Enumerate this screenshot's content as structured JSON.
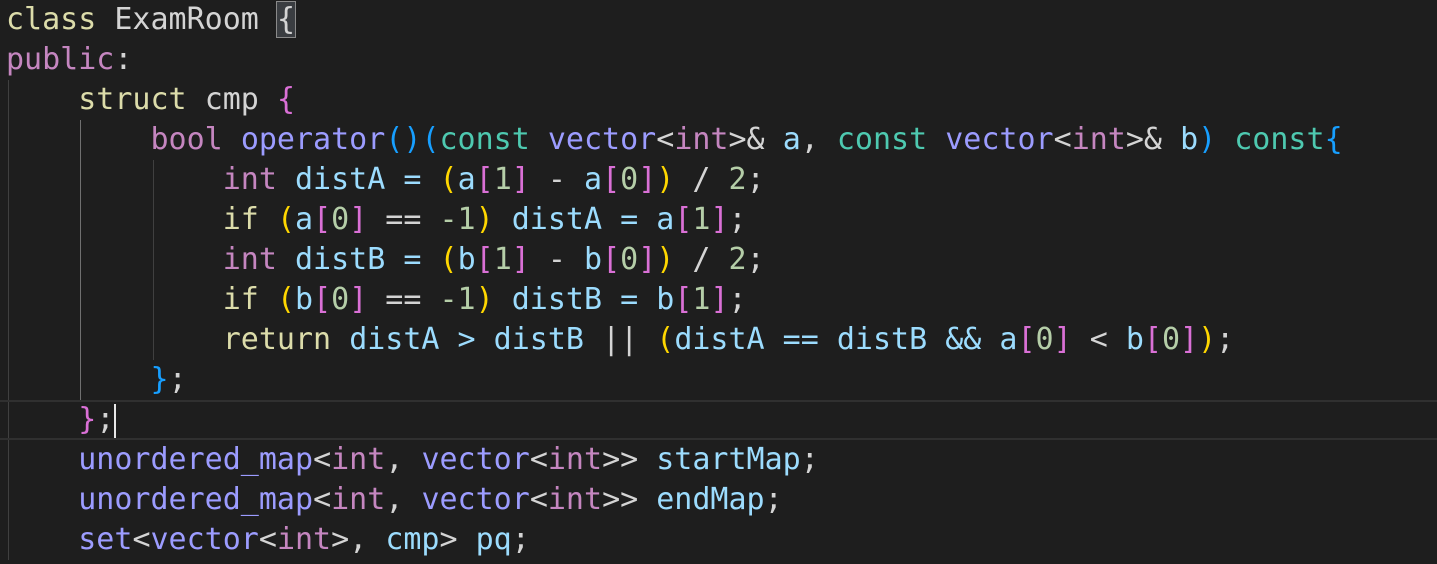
{
  "colors": {
    "background": "#1e1e1e",
    "keyword_purple": "#c586c0",
    "keyword_yellow": "#dcdcaa",
    "type_blue": "#9c9cff",
    "teal": "#4ec9b0",
    "plain": "#d4d4d4",
    "number": "#b5cea8",
    "bracket_gold": "#ffd700",
    "bracket_purple": "#da70d6",
    "bracket_blue": "#179fff"
  },
  "lines": [
    [
      {
        "t": "class ",
        "c": "#dcdcaa"
      },
      {
        "t": "ExamRoom ",
        "c": "#d4d4d4"
      },
      {
        "t": "{",
        "c": "#d4d4d4",
        "box": true
      }
    ],
    [
      {
        "t": "public",
        "c": "#c586c0"
      },
      {
        "t": ":",
        "c": "#d4d4d4"
      }
    ],
    [
      {
        "t": "    ",
        "c": "#d4d4d4"
      },
      {
        "t": "struct ",
        "c": "#dcdcaa"
      },
      {
        "t": "cmp ",
        "c": "#d4d4d4"
      },
      {
        "t": "{",
        "c": "#da70d6"
      }
    ],
    [
      {
        "t": "        ",
        "c": "#d4d4d4"
      },
      {
        "t": "bool ",
        "c": "#c586c0"
      },
      {
        "t": "operator",
        "c": "#9c9cff"
      },
      {
        "t": "()",
        "c": "#179fff"
      },
      {
        "t": "(",
        "c": "#179fff"
      },
      {
        "t": "const ",
        "c": "#4ec9b0"
      },
      {
        "t": "vector",
        "c": "#9c9cff"
      },
      {
        "t": "<",
        "c": "#d4d4d4"
      },
      {
        "t": "int",
        "c": "#c586c0"
      },
      {
        "t": ">& ",
        "c": "#d4d4d4"
      },
      {
        "t": "a",
        "c": "#9cdcfe"
      },
      {
        "t": ", ",
        "c": "#d4d4d4"
      },
      {
        "t": "const ",
        "c": "#4ec9b0"
      },
      {
        "t": "vector",
        "c": "#9c9cff"
      },
      {
        "t": "<",
        "c": "#d4d4d4"
      },
      {
        "t": "int",
        "c": "#c586c0"
      },
      {
        "t": ">& ",
        "c": "#d4d4d4"
      },
      {
        "t": "b",
        "c": "#9cdcfe"
      },
      {
        "t": ") ",
        "c": "#179fff"
      },
      {
        "t": "const",
        "c": "#4ec9b0"
      },
      {
        "t": "{",
        "c": "#179fff"
      }
    ],
    [
      {
        "t": "            ",
        "c": "#d4d4d4"
      },
      {
        "t": "int ",
        "c": "#c586c0"
      },
      {
        "t": "distA = ",
        "c": "#9cdcfe"
      },
      {
        "t": "(",
        "c": "#ffd700"
      },
      {
        "t": "a",
        "c": "#9cdcfe"
      },
      {
        "t": "[",
        "c": "#da70d6"
      },
      {
        "t": "1",
        "c": "#b5cea8"
      },
      {
        "t": "]",
        "c": "#da70d6"
      },
      {
        "t": " - ",
        "c": "#d4d4d4"
      },
      {
        "t": "a",
        "c": "#9cdcfe"
      },
      {
        "t": "[",
        "c": "#da70d6"
      },
      {
        "t": "0",
        "c": "#b5cea8"
      },
      {
        "t": "]",
        "c": "#da70d6"
      },
      {
        "t": ")",
        "c": "#ffd700"
      },
      {
        "t": " / ",
        "c": "#d4d4d4"
      },
      {
        "t": "2",
        "c": "#b5cea8"
      },
      {
        "t": ";",
        "c": "#d4d4d4"
      }
    ],
    [
      {
        "t": "            ",
        "c": "#d4d4d4"
      },
      {
        "t": "if ",
        "c": "#dcdcaa"
      },
      {
        "t": "(",
        "c": "#ffd700"
      },
      {
        "t": "a",
        "c": "#9cdcfe"
      },
      {
        "t": "[",
        "c": "#da70d6"
      },
      {
        "t": "0",
        "c": "#b5cea8"
      },
      {
        "t": "]",
        "c": "#da70d6"
      },
      {
        "t": " == ",
        "c": "#d4d4d4"
      },
      {
        "t": "-1",
        "c": "#b5cea8"
      },
      {
        "t": ")",
        "c": "#ffd700"
      },
      {
        "t": " distA = ",
        "c": "#9cdcfe"
      },
      {
        "t": "a",
        "c": "#9cdcfe"
      },
      {
        "t": "[",
        "c": "#da70d6"
      },
      {
        "t": "1",
        "c": "#b5cea8"
      },
      {
        "t": "]",
        "c": "#da70d6"
      },
      {
        "t": ";",
        "c": "#d4d4d4"
      }
    ],
    [
      {
        "t": "            ",
        "c": "#d4d4d4"
      },
      {
        "t": "int ",
        "c": "#c586c0"
      },
      {
        "t": "distB = ",
        "c": "#9cdcfe"
      },
      {
        "t": "(",
        "c": "#ffd700"
      },
      {
        "t": "b",
        "c": "#9cdcfe"
      },
      {
        "t": "[",
        "c": "#da70d6"
      },
      {
        "t": "1",
        "c": "#b5cea8"
      },
      {
        "t": "]",
        "c": "#da70d6"
      },
      {
        "t": " - ",
        "c": "#d4d4d4"
      },
      {
        "t": "b",
        "c": "#9cdcfe"
      },
      {
        "t": "[",
        "c": "#da70d6"
      },
      {
        "t": "0",
        "c": "#b5cea8"
      },
      {
        "t": "]",
        "c": "#da70d6"
      },
      {
        "t": ")",
        "c": "#ffd700"
      },
      {
        "t": " / ",
        "c": "#d4d4d4"
      },
      {
        "t": "2",
        "c": "#b5cea8"
      },
      {
        "t": ";",
        "c": "#d4d4d4"
      }
    ],
    [
      {
        "t": "            ",
        "c": "#d4d4d4"
      },
      {
        "t": "if ",
        "c": "#dcdcaa"
      },
      {
        "t": "(",
        "c": "#ffd700"
      },
      {
        "t": "b",
        "c": "#9cdcfe"
      },
      {
        "t": "[",
        "c": "#da70d6"
      },
      {
        "t": "0",
        "c": "#b5cea8"
      },
      {
        "t": "]",
        "c": "#da70d6"
      },
      {
        "t": " == ",
        "c": "#d4d4d4"
      },
      {
        "t": "-1",
        "c": "#b5cea8"
      },
      {
        "t": ")",
        "c": "#ffd700"
      },
      {
        "t": " distB = ",
        "c": "#9cdcfe"
      },
      {
        "t": "b",
        "c": "#9cdcfe"
      },
      {
        "t": "[",
        "c": "#da70d6"
      },
      {
        "t": "1",
        "c": "#b5cea8"
      },
      {
        "t": "]",
        "c": "#da70d6"
      },
      {
        "t": ";",
        "c": "#d4d4d4"
      }
    ],
    [
      {
        "t": "            ",
        "c": "#d4d4d4"
      },
      {
        "t": "return ",
        "c": "#dcdcaa"
      },
      {
        "t": "distA > distB ",
        "c": "#9cdcfe"
      },
      {
        "t": "|| ",
        "c": "#d4d4d4"
      },
      {
        "t": "(",
        "c": "#ffd700"
      },
      {
        "t": "distA == distB && ",
        "c": "#9cdcfe"
      },
      {
        "t": "a",
        "c": "#9cdcfe"
      },
      {
        "t": "[",
        "c": "#da70d6"
      },
      {
        "t": "0",
        "c": "#b5cea8"
      },
      {
        "t": "]",
        "c": "#da70d6"
      },
      {
        "t": " < ",
        "c": "#d4d4d4"
      },
      {
        "t": "b",
        "c": "#9cdcfe"
      },
      {
        "t": "[",
        "c": "#da70d6"
      },
      {
        "t": "0",
        "c": "#b5cea8"
      },
      {
        "t": "]",
        "c": "#da70d6"
      },
      {
        "t": ")",
        "c": "#ffd700"
      },
      {
        "t": ";",
        "c": "#d4d4d4"
      }
    ],
    [
      {
        "t": "        ",
        "c": "#d4d4d4"
      },
      {
        "t": "}",
        "c": "#179fff"
      },
      {
        "t": ";",
        "c": "#d4d4d4"
      }
    ],
    [
      {
        "t": "    ",
        "c": "#d4d4d4"
      },
      {
        "t": "}",
        "c": "#da70d6"
      },
      {
        "t": ";",
        "c": "#d4d4d4"
      }
    ],
    [
      {
        "t": "    ",
        "c": "#d4d4d4"
      },
      {
        "t": "unordered_map",
        "c": "#9c9cff"
      },
      {
        "t": "<",
        "c": "#d4d4d4"
      },
      {
        "t": "int",
        "c": "#c586c0"
      },
      {
        "t": ", ",
        "c": "#d4d4d4"
      },
      {
        "t": "vector",
        "c": "#9c9cff"
      },
      {
        "t": "<",
        "c": "#d4d4d4"
      },
      {
        "t": "int",
        "c": "#c586c0"
      },
      {
        "t": ">> ",
        "c": "#d4d4d4"
      },
      {
        "t": "startMap",
        "c": "#9cdcfe"
      },
      {
        "t": ";",
        "c": "#d4d4d4"
      }
    ],
    [
      {
        "t": "    ",
        "c": "#d4d4d4"
      },
      {
        "t": "unordered_map",
        "c": "#9c9cff"
      },
      {
        "t": "<",
        "c": "#d4d4d4"
      },
      {
        "t": "int",
        "c": "#c586c0"
      },
      {
        "t": ", ",
        "c": "#d4d4d4"
      },
      {
        "t": "vector",
        "c": "#9c9cff"
      },
      {
        "t": "<",
        "c": "#d4d4d4"
      },
      {
        "t": "int",
        "c": "#c586c0"
      },
      {
        "t": ">> ",
        "c": "#d4d4d4"
      },
      {
        "t": "endMap",
        "c": "#9cdcfe"
      },
      {
        "t": ";",
        "c": "#d4d4d4"
      }
    ],
    [
      {
        "t": "    ",
        "c": "#d4d4d4"
      },
      {
        "t": "set",
        "c": "#9c9cff"
      },
      {
        "t": "<",
        "c": "#d4d4d4"
      },
      {
        "t": "vector",
        "c": "#9c9cff"
      },
      {
        "t": "<",
        "c": "#d4d4d4"
      },
      {
        "t": "int",
        "c": "#c586c0"
      },
      {
        "t": ">, ",
        "c": "#d4d4d4"
      },
      {
        "t": "cmp",
        "c": "#9cdcfe"
      },
      {
        "t": "> ",
        "c": "#d4d4d4"
      },
      {
        "t": "pq",
        "c": "#9cdcfe"
      },
      {
        "t": ";",
        "c": "#d4d4d4"
      }
    ]
  ]
}
